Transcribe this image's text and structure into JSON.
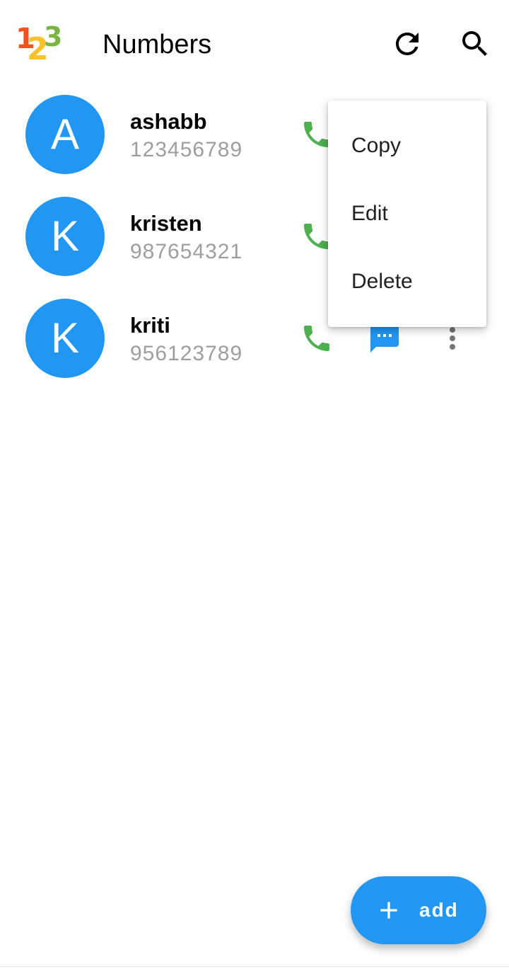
{
  "appbar": {
    "logo_digits": [
      "1",
      "2",
      "3"
    ],
    "title": "Numbers",
    "refresh_icon": "refresh-icon",
    "search_icon": "search-icon"
  },
  "contacts": [
    {
      "initial": "A",
      "name": "ashabb",
      "number": "123456789"
    },
    {
      "initial": "K",
      "name": "kristen",
      "number": "987654321"
    },
    {
      "initial": "K",
      "name": "kriti",
      "number": "956123789"
    }
  ],
  "row_icons": {
    "call": "phone-icon",
    "message": "message-icon",
    "more": "more-vert-icon"
  },
  "context_menu": {
    "items": [
      "Copy",
      "Edit",
      "Delete"
    ]
  },
  "fab": {
    "label": "add",
    "icon": "plus-icon"
  },
  "colors": {
    "accent": "#2196f3",
    "call_green": "#4caf50",
    "secondary_text": "#9e9e9e"
  }
}
